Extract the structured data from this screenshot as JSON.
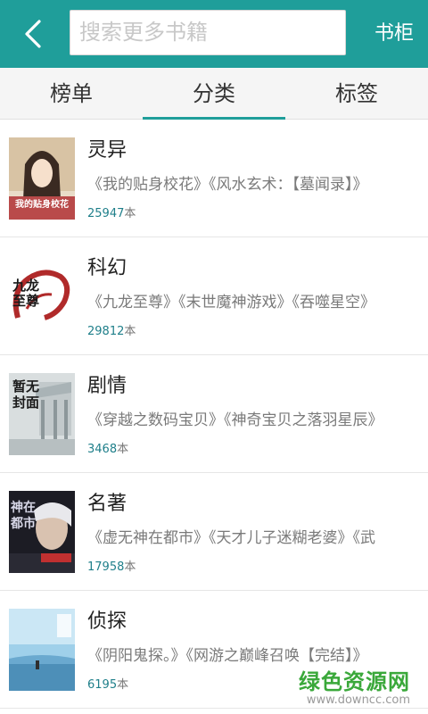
{
  "header": {
    "search_placeholder": "搜索更多书籍",
    "shelf_label": "书柜"
  },
  "tabs": [
    {
      "label": "榜单"
    },
    {
      "label": "分类"
    },
    {
      "label": "标签"
    }
  ],
  "categories": [
    {
      "name": "灵异",
      "books": "《我的贴身校花》《风水玄术：【墓闻录】》",
      "count_num": "25947",
      "count_unit": "本"
    },
    {
      "name": "科幻",
      "books": "《九龙至尊》《末世魔神游戏》《吞噬星空》",
      "count_num": "29812",
      "count_unit": "本"
    },
    {
      "name": "剧情",
      "books": "《穿越之数码宝贝》《神奇宝贝之落羽星辰》",
      "count_num": "3468",
      "count_unit": "本"
    },
    {
      "name": "名著",
      "books": "《虚无神在都市》《天才儿子迷糊老婆》《武",
      "count_num": "17958",
      "count_unit": "本"
    },
    {
      "name": "侦探",
      "books": "《阴阳鬼探。》《网游之巅峰召唤【完结】》",
      "count_num": "6195",
      "count_unit": "本"
    }
  ],
  "covers": [
    {
      "text": "我的贴身校花"
    },
    {
      "text": "九龙至尊"
    },
    {
      "text": "暂无封面"
    },
    {
      "text": "神在都市"
    },
    {
      "text": ""
    }
  ],
  "watermark": {
    "title": "绿色资源网",
    "url": "www.downcc.com"
  },
  "colors": {
    "accent": "#1f9e9a",
    "watermark": "#3aa83a"
  }
}
